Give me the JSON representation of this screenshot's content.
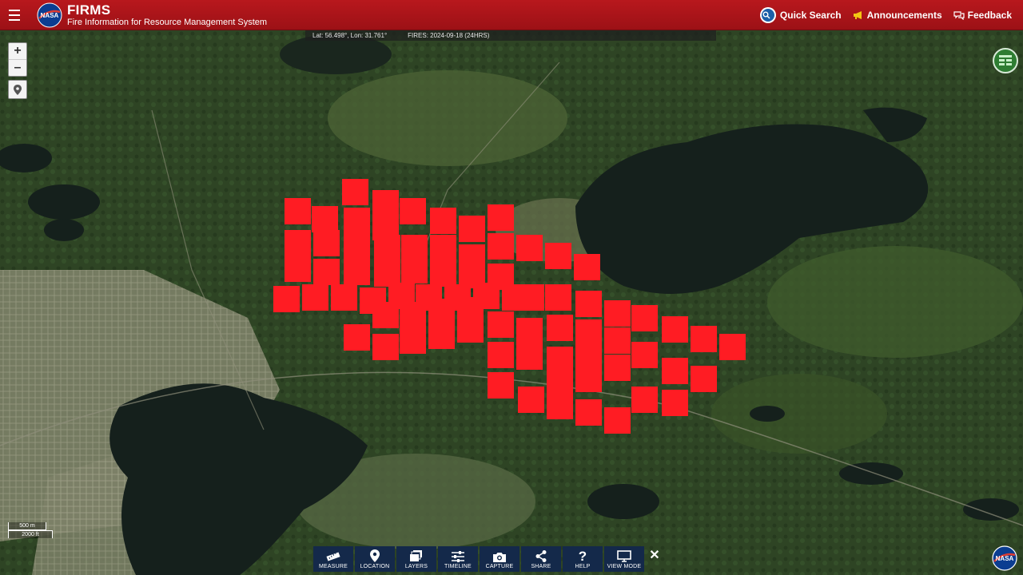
{
  "header": {
    "menu_icon": "hamburger-icon",
    "logo_icon": "nasa-logo-icon",
    "title": "FIRMS",
    "subtitle": "Fire Information for Resource Management System",
    "quick_search": "Quick Search",
    "announcements": "Announcements",
    "feedback": "Feedback"
  },
  "map": {
    "coordinates": "Lat: 56.498°, Lon: 31.761°",
    "fires_label": "FIRES: 2024-09-18 (24HRS)",
    "zoom_in": "+",
    "zoom_out": "–",
    "scale_metric": "500 m",
    "scale_imperial": "2000 ft",
    "fire_color": "#ff1c23"
  },
  "toolbar": {
    "items": [
      {
        "label": "MEASURE",
        "icon": "ruler-icon"
      },
      {
        "label": "LOCATION",
        "icon": "map-pin-icon"
      },
      {
        "label": "LAYERS",
        "icon": "layers-icon"
      },
      {
        "label": "TIMELINE",
        "icon": "sliders-icon"
      },
      {
        "label": "CAPTURE",
        "icon": "camera-icon"
      },
      {
        "label": "SHARE",
        "icon": "share-icon"
      },
      {
        "label": "HELP",
        "icon": "question-icon"
      },
      {
        "label": "VIEW MODE",
        "icon": "monitor-icon"
      }
    ],
    "close": "✕"
  }
}
